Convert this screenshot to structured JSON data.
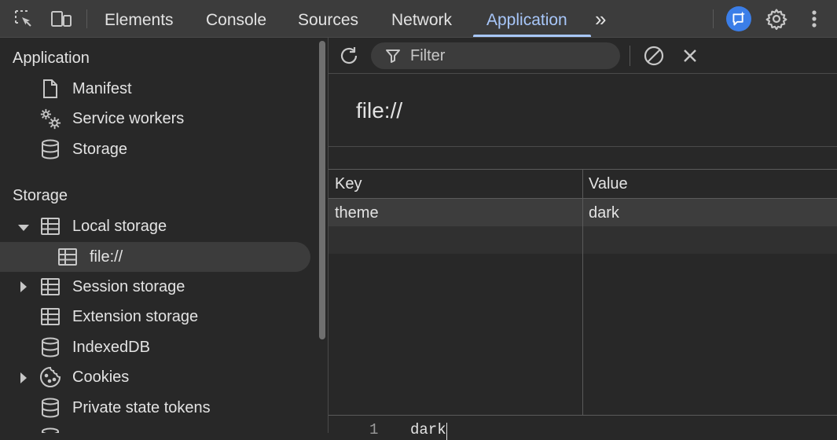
{
  "toolbar": {
    "tabs": [
      {
        "label": "Elements"
      },
      {
        "label": "Console"
      },
      {
        "label": "Sources"
      },
      {
        "label": "Network"
      },
      {
        "label": "Application"
      }
    ],
    "active_tab": "Application",
    "overflow_label": "»",
    "accent_color": "#a8c7fa"
  },
  "sidebar": {
    "application_section": {
      "title": "Application",
      "items": [
        {
          "label": "Manifest",
          "icon": "document-icon"
        },
        {
          "label": "Service workers",
          "icon": "gears-icon"
        },
        {
          "label": "Storage",
          "icon": "database-icon"
        }
      ]
    },
    "storage_section": {
      "title": "Storage",
      "items": [
        {
          "label": "Local storage",
          "icon": "table-icon",
          "expanded": true
        },
        {
          "label": "file://",
          "icon": "table-icon",
          "selected": true
        },
        {
          "label": "Session storage",
          "icon": "table-icon",
          "expanded": false
        },
        {
          "label": "Extension storage",
          "icon": "table-icon"
        },
        {
          "label": "IndexedDB",
          "icon": "database-icon"
        },
        {
          "label": "Cookies",
          "icon": "cookie-icon",
          "expanded": false
        },
        {
          "label": "Private state tokens",
          "icon": "database-icon"
        }
      ]
    }
  },
  "main": {
    "filter": {
      "placeholder": "Filter",
      "value": ""
    },
    "origin": "file://",
    "table": {
      "headers": [
        "Key",
        "Value"
      ],
      "rows": [
        {
          "key": "theme",
          "value": "dark"
        }
      ]
    },
    "preview": {
      "line_number": "1",
      "text": "dark"
    }
  }
}
